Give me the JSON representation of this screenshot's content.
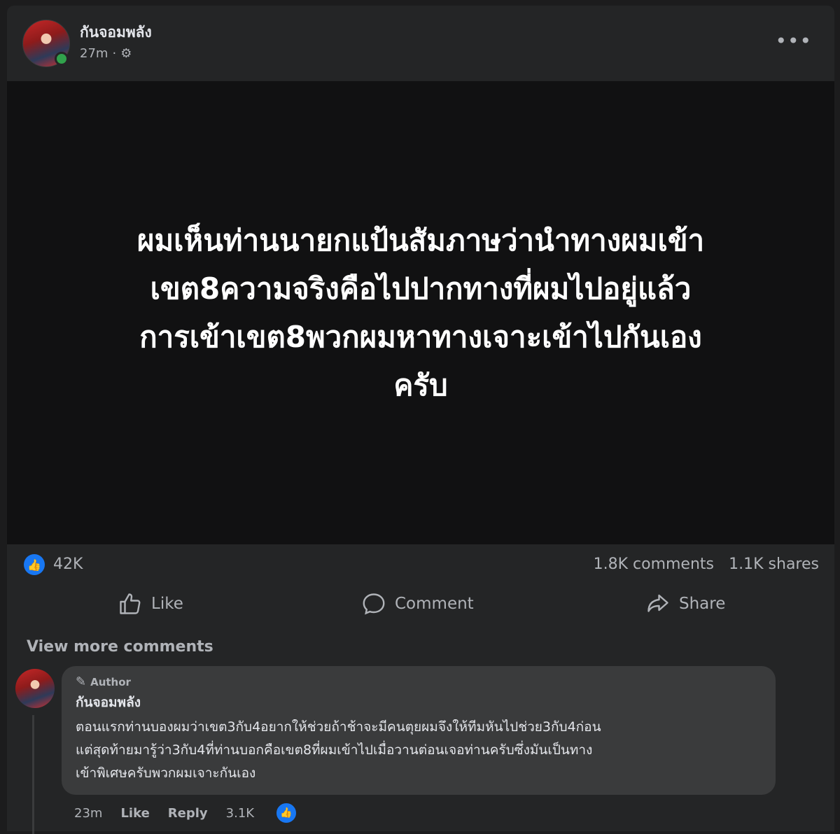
{
  "post": {
    "author": "กันจอมพลัง",
    "time": "27m",
    "audience_icon": "gear-icon",
    "more_label": "•••",
    "image_text_lines": [
      "ผมเห็นท่านนายกแป้นสัมภาษว่านำทางผมเข้า",
      "เขต8ความจริงคือไปปากทางที่ผมไปอยู่แล้ว",
      "การเข้าเขต8พวกผมหาทางเจาะเข้าไปกันเอง",
      "ครับ"
    ]
  },
  "stats": {
    "reactions": "42K",
    "comments": "1.8K comments",
    "shares": "1.1K shares"
  },
  "actions": {
    "like": "Like",
    "comment": "Comment",
    "share": "Share"
  },
  "view_more": "View more comments",
  "comment": {
    "badge": "Author",
    "name": "กันจอมพลัง",
    "text_lines": [
      "ตอนแรกท่านบองผมว่าเขต3กับ4อยากให้ช่วยถ้าช้าจะมีคนตุยผมจึงให้ทีมหันไปช่วย3กับ4ก่อน",
      "แต่สุดท้ายมารู้ว่า3กับ4ที่ท่านบอกคือเขต8ที่ผมเข้าไปเมื่อวานต่อนเจอท่านครับซึ่งมันเป็นทาง",
      "เข้าพิเศษครับพวกผมเจาะกันเอง"
    ],
    "time": "23m",
    "like": "Like",
    "reply": "Reply",
    "reactions": "3.1K"
  },
  "colors": {
    "background": "#242526",
    "media": "#111112",
    "bubble": "#3a3b3c",
    "accent": "#1877f2",
    "online": "#31a24c"
  }
}
